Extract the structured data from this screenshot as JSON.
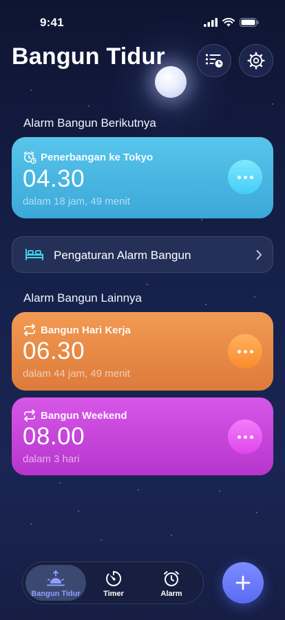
{
  "status_bar": {
    "time": "9:41"
  },
  "header": {
    "title": "Bangun Tidur",
    "list_icon": "list-clock-icon",
    "settings_icon": "gear-icon"
  },
  "next_section": {
    "title": "Alarm Bangun Berikutnya",
    "alarm": {
      "label": "Penerbangan ke Tokyo",
      "time": "04.30",
      "subtitle": "dalam 18 jam, 49 menit",
      "icon": "alarm-clock-icon",
      "color": "#4bb8e3"
    }
  },
  "settings_row": {
    "label": "Pengaturan Alarm Bangun",
    "icon": "bed-icon"
  },
  "other_section": {
    "title": "Alarm Bangun Lainnya",
    "alarms": [
      {
        "label": "Bangun Hari Kerja",
        "time": "06.30",
        "subtitle": "dalam 44 jam, 49 menit",
        "icon": "repeat-icon",
        "color": "#e88a47"
      },
      {
        "label": "Bangun Weekend",
        "time": "08.00",
        "subtitle": "dalam 3 hari",
        "icon": "repeat-icon",
        "color": "#c645db"
      }
    ]
  },
  "tab_bar": {
    "tabs": [
      {
        "label": "Bangun Tidur",
        "icon": "sunrise-icon",
        "active": true
      },
      {
        "label": "Timer",
        "icon": "timer-icon",
        "active": false
      },
      {
        "label": "Alarm",
        "icon": "alarm-clock-icon",
        "active": false
      }
    ],
    "add_icon": "plus-icon",
    "accent": "#6a7bff"
  }
}
